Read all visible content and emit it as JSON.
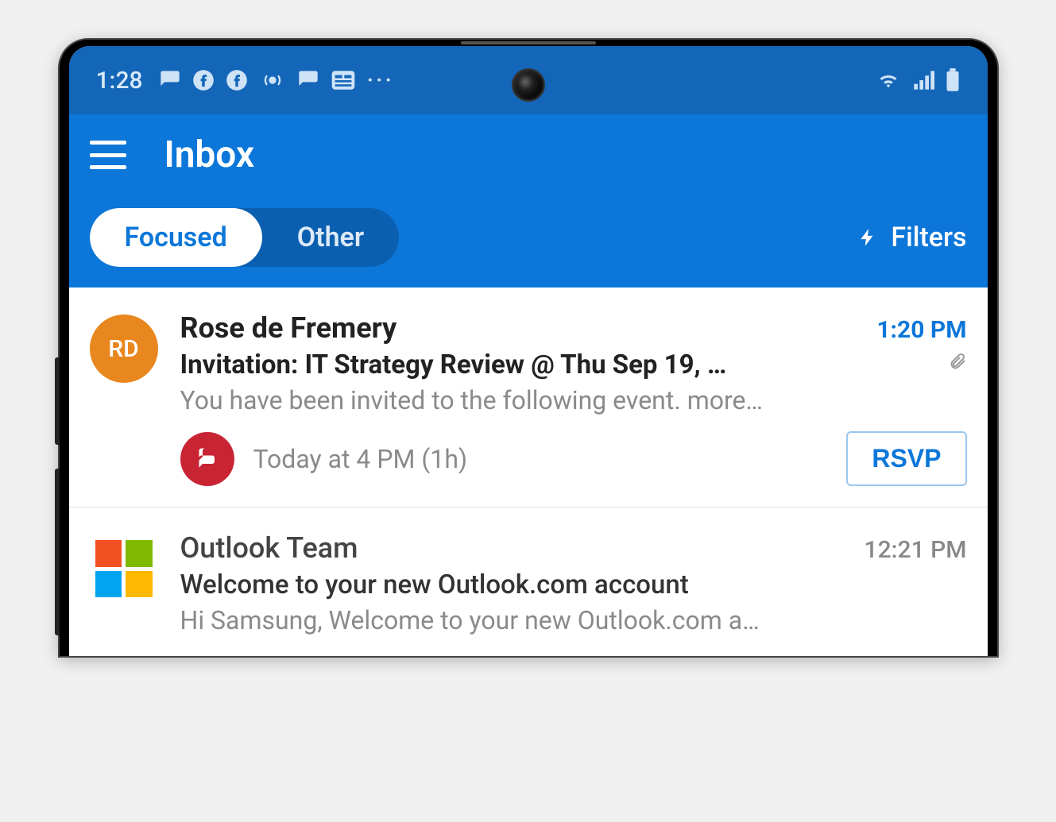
{
  "status_bar": {
    "time": "1:28",
    "more": "···"
  },
  "header": {
    "title": "Inbox",
    "tabs": {
      "focused": "Focused",
      "other": "Other"
    },
    "filters_label": "Filters"
  },
  "emails": [
    {
      "avatar_initials": "RD",
      "sender": "Rose de Fremery",
      "time": "1:20 PM",
      "subject": "Invitation: IT Strategy Review @ Thu Sep 19, …",
      "preview": "You have been invited to the following event. more…",
      "has_attachment": true,
      "event_time": "Today at 4 PM (1h)",
      "rsvp_label": "RSVP",
      "unread": true
    },
    {
      "sender": "Outlook Team",
      "time": "12:21 PM",
      "subject": "Welcome to your new Outlook.com account",
      "preview": "Hi Samsung, Welcome to your new Outlook.com a…",
      "has_attachment": false,
      "unread": false
    }
  ]
}
